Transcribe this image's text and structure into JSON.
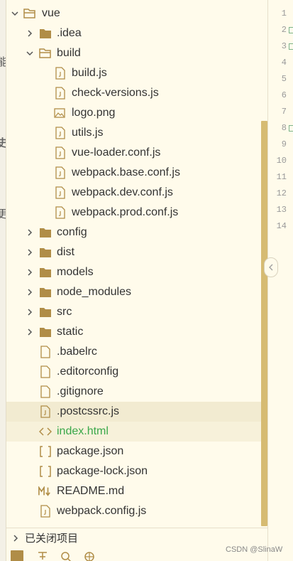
{
  "left_strip": {
    "fragments": [
      "能",
      "更",
      "史"
    ]
  },
  "tree": {
    "root": {
      "label": "vue"
    },
    "items": [
      {
        "label": ".idea"
      },
      {
        "label": "build"
      },
      {
        "label": "build.js"
      },
      {
        "label": "check-versions.js"
      },
      {
        "label": "logo.png"
      },
      {
        "label": "utils.js"
      },
      {
        "label": "vue-loader.conf.js"
      },
      {
        "label": "webpack.base.conf.js"
      },
      {
        "label": "webpack.dev.conf.js"
      },
      {
        "label": "webpack.prod.conf.js"
      },
      {
        "label": "config"
      },
      {
        "label": "dist"
      },
      {
        "label": "models"
      },
      {
        "label": "node_modules"
      },
      {
        "label": "src"
      },
      {
        "label": "static"
      },
      {
        "label": ".babelrc"
      },
      {
        "label": ".editorconfig"
      },
      {
        "label": ".gitignore"
      },
      {
        "label": ".postcssrc.js"
      },
      {
        "label": "index.html",
        "color": "#3aa84a"
      },
      {
        "label": "package.json"
      },
      {
        "label": "package-lock.json"
      },
      {
        "label": "README.md"
      },
      {
        "label": "webpack.config.js"
      }
    ]
  },
  "gutter": {
    "line_numbers": [
      "1",
      "2",
      "3",
      "4",
      "5",
      "6",
      "7",
      "8",
      "9",
      "10",
      "11",
      "12",
      "13",
      "14"
    ]
  },
  "footer": {
    "closed_projects_label": "已关闭项目",
    "watermark": "CSDN @SlinaW"
  },
  "colors": {
    "background": "#fffbeb",
    "folder": "#b08d47",
    "scrollbar": "#d6bb72",
    "selection": "#f2ebd1",
    "html_file": "#3aa84a"
  }
}
